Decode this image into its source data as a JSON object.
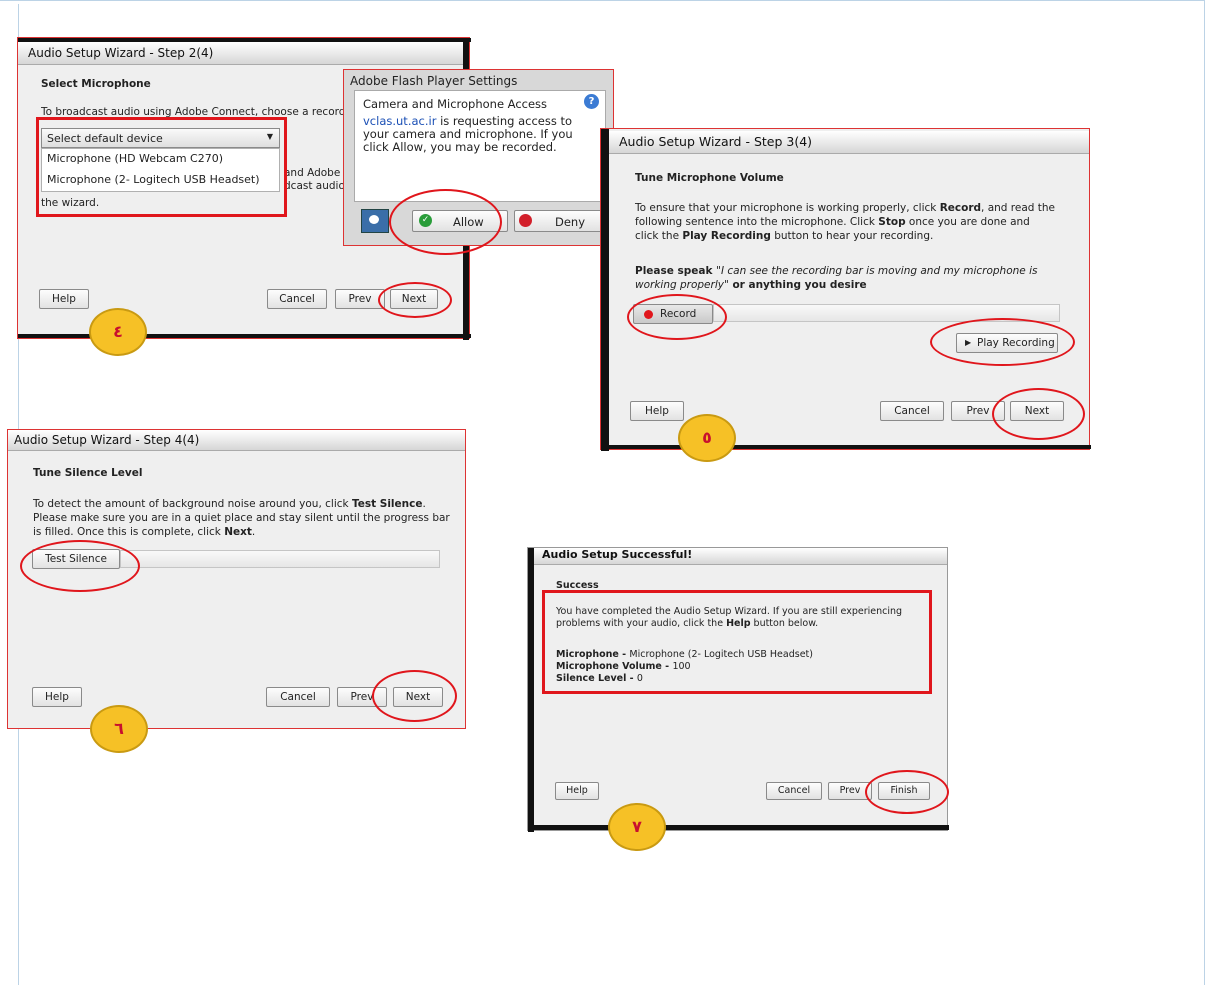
{
  "step2": {
    "title": "Audio Setup Wizard - Step 2(4)",
    "heading": "Select Microphone",
    "intro": "To broadcast audio using Adobe Connect, choose a recording d",
    "select_value": "Select default device",
    "options": [
      "Microphone (HD Webcam C270)",
      "Microphone (2- Logitech USB Headset)"
    ],
    "partial_text_1": "and Adobe C",
    "partial_text_2": "dcast audio,",
    "wizard_text": "the wizard.",
    "help": "Help",
    "cancel": "Cancel",
    "prev": "Prev",
    "next": "Next",
    "badge": "٤"
  },
  "flash": {
    "title": "Adobe Flash Player Settings",
    "heading": "Camera and Microphone Access",
    "help_glyph": "?",
    "link": "vclas.ut.ac.ir",
    "message": " is requesting access to your camera and microphone. If you click Allow, you may be recorded.",
    "allow": "Allow",
    "deny": "Deny"
  },
  "step3": {
    "title": "Audio Setup Wizard - Step 3(4)",
    "heading": "Tune Microphone Volume",
    "p1_a": "To ensure that your microphone is working properly, click ",
    "p1_b": "Record",
    "p1_c": ", and read the following sentence into the microphone. Click ",
    "p1_d": "Stop",
    "p1_e": " once you are done and click the ",
    "p1_f": "Play Recording",
    "p1_g": " button to hear your recording.",
    "speak_label": "Please speak ",
    "speak_quote": "\"I can see the recording bar is moving and my microphone is working properly\"",
    "speak_tail": " or anything you desire",
    "record": "Record",
    "play": "Play Recording",
    "help": "Help",
    "cancel": "Cancel",
    "prev": "Prev",
    "next": "Next",
    "badge": "٥"
  },
  "step4": {
    "title": "Audio Setup Wizard - Step 4(4)",
    "heading": "Tune Silence Level",
    "p_a": "To detect the amount of background noise around you, click ",
    "p_b": "Test Silence",
    "p_c": ". Please make sure you are in a quiet place and stay silent until the progress bar is filled. Once this is complete, click ",
    "p_d": "Next",
    "p_e": ".",
    "test": "Test Silence",
    "help": "Help",
    "cancel": "Cancel",
    "prev": "Prev",
    "next": "Next",
    "badge": "٦"
  },
  "success": {
    "title": "Audio Setup Successful!",
    "heading": "Success",
    "p_a": "You have completed the Audio Setup Wizard. If you are still experiencing problems with your audio, click the ",
    "p_b": "Help",
    "p_c": " button below.",
    "mic_label": "Microphone - ",
    "mic_value": "Microphone (2- Logitech USB Headset)",
    "vol_label": "Microphone Volume - ",
    "vol_value": "100",
    "sil_label": "Silence Level - ",
    "sil_value": "0",
    "help": "Help",
    "cancel": "Cancel",
    "prev": "Prev",
    "finish": "Finish",
    "badge": "٧"
  },
  "colors": {
    "highlight": "#e0161c",
    "badge": "#f6c126",
    "badge_text": "#c8102e",
    "link": "#1a4fb5"
  }
}
